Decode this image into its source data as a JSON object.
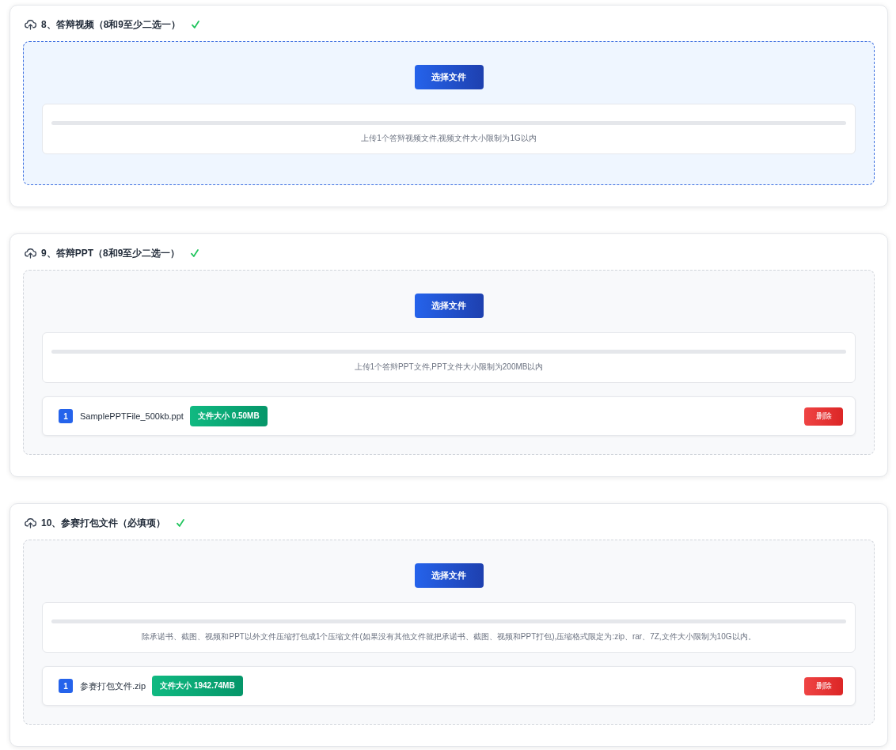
{
  "sections": [
    {
      "title": "8、答辩视频（8和9至少二选一）",
      "completed": true,
      "dropzone": {
        "active": true,
        "button": "选择文件",
        "progress": {
          "level": 0
        },
        "hint": "上传1个答辩视频文件,视频文件大小限制为1G以内"
      }
    },
    {
      "title": "9、答辩PPT（8和9至少二选一）",
      "completed": true,
      "dropzone": {
        "active": false,
        "button": "选择文件",
        "progress": {
          "level": 0
        },
        "hint": "上传1个答辩PPT文件,PPT文件大小限制为200MB以内"
      },
      "files": [
        {
          "index": "1",
          "name": "SamplePPTFile_500kb.ppt",
          "size": "文件大小 0.50MB",
          "delete": "删除"
        }
      ]
    },
    {
      "title": "10、参赛打包文件（必填项）",
      "completed": true,
      "dropzone": {
        "active": false,
        "button": "选择文件",
        "progress": {
          "level": 0
        },
        "hint": "除承诺书、截图、视频和PPT以外文件压缩打包成1个压缩文件(如果没有其他文件就把承诺书、截图、视频和PPT打包),压缩格式限定为:zip、rar、7Z,文件大小限制为10G以内。"
      },
      "files": [
        {
          "index": "1",
          "name": "参赛打包文件.zip",
          "size": "文件大小 1942.74MB",
          "delete": "删除"
        }
      ]
    }
  ]
}
